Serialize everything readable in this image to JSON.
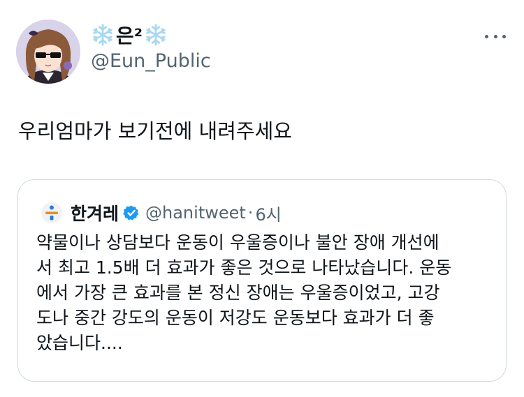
{
  "post": {
    "author": {
      "display_name": "은²",
      "handle": "@Eun_Public",
      "avatar_icon": "anime-avatar-with-sunglasses"
    },
    "more_icon": "more-horizontal-icon",
    "text": "우리엄마가 보기전에 내려주세요"
  },
  "quoted_post": {
    "author": {
      "display_name": "한겨레",
      "handle": "@hanitweet",
      "verified": true,
      "logo_icon": "hankyoreh-logo-icon"
    },
    "separator": "·",
    "time": "6시",
    "text": "약물이나 상담보다 운동이 우울증이나 불안 장애 개선에\n서 최고 1.5배 더 효과가 좋은 것으로 나타났습니다. 운동\n에서 가장 큰 효과를 본 정신 장애는 우울증이었고, 고강\n도나 중간 강도의 운동이 저강도 운동보다 효과가 더 좋\n았습니다...."
  },
  "colors": {
    "text": "#0f1419",
    "secondary": "#536471",
    "border": "#cfd9de",
    "verified": "#1d9bf0",
    "snowflake": "#a8d8f0",
    "logo_blue": "#2b7cd3",
    "logo_orange": "#f08a1c"
  }
}
